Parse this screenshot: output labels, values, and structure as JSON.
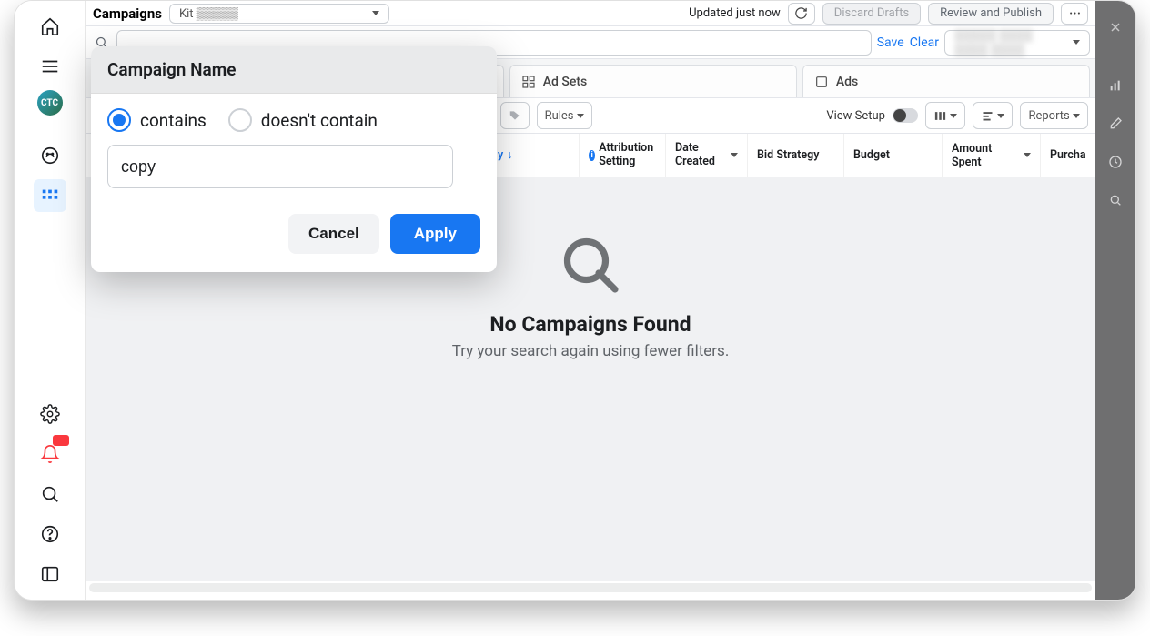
{
  "header": {
    "title": "Campaigns",
    "account_selected": "Kit ▒▒▒▒▒",
    "status_text": "Updated just now",
    "discard_label": "Discard Drafts",
    "review_label": "Review and Publish"
  },
  "filterbar": {
    "save": "Save",
    "clear": "Clear",
    "date_label": "▒▒▒▒▒ ▒▒▒▒ ▒▒▒▒ ▒▒▒▒"
  },
  "tabs": {
    "ad_sets": "Ad Sets",
    "ads": "Ads"
  },
  "toolbar": {
    "rules": "Rules",
    "view_setup": "View Setup",
    "reports": "Reports"
  },
  "columns": {
    "delivery_sort": "y",
    "attribution": "Attribution Setting",
    "date_created": "Date Created",
    "bid_strategy": "Bid Strategy",
    "budget": "Budget",
    "amount_spent": "Amount Spent",
    "purchases": "Purcha"
  },
  "empty": {
    "title": "No Campaigns Found",
    "subtitle": "Try your search again using fewer filters."
  },
  "popover": {
    "title": "Campaign Name",
    "opt_contains": "contains",
    "opt_not_contain": "doesn't contain",
    "input_value": "copy",
    "cancel": "Cancel",
    "apply": "Apply"
  }
}
